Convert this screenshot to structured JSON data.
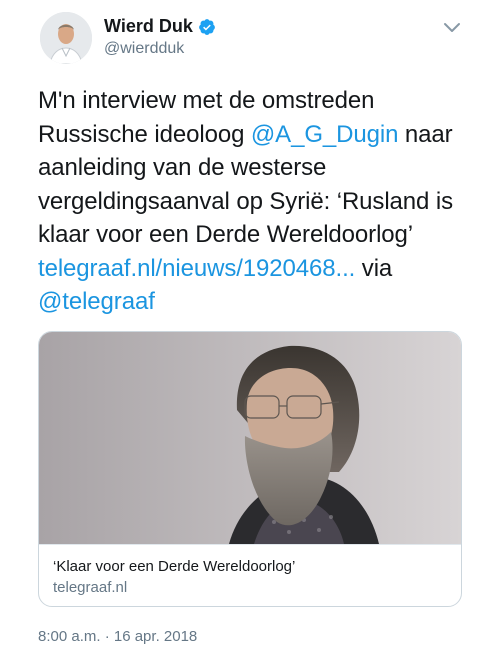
{
  "author": {
    "display_name": "Wierd Duk",
    "handle": "@wierdduk",
    "verified_icon": "verified-badge-icon",
    "verified_color": "#1da1f2"
  },
  "tweet": {
    "segments": [
      {
        "text": "M'n interview met de omstreden"
      },
      {
        "text": "Russische ideoloog "
      },
      {
        "text": "@A_G_Dugin",
        "type": "mention"
      },
      {
        "text": " naar"
      },
      {
        "text": "aanleiding van de westerse"
      },
      {
        "text": "vergeldingsaanval op Syrië: ‘Rusland is"
      },
      {
        "text": "klaar voor een Derde Wereldoorlog’"
      },
      {
        "text": "telegraaf.nl/nieuws/1920468...",
        "type": "link"
      },
      {
        "text": " via"
      },
      {
        "text": "@telegraaf",
        "type": "mention"
      }
    ],
    "link_color": "#1b95e0"
  },
  "card": {
    "title": "‘Klaar voor een Derde Wereldoorlog’",
    "domain": "telegraaf.nl"
  },
  "timestamp": "8:00 a.m. · 16 apr. 2018",
  "colors": {
    "text": "#14171a",
    "secondary": "#657786",
    "border": "#ccd6dd"
  }
}
